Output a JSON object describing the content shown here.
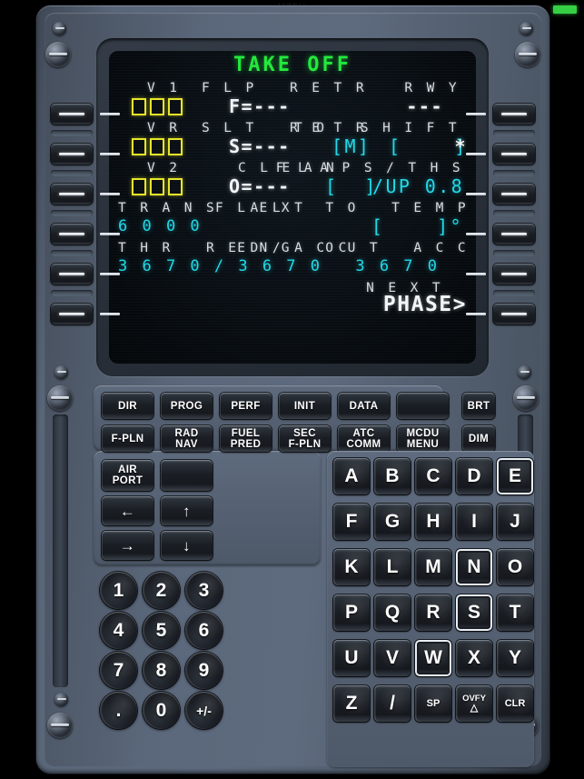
{
  "watermark": "MCDU",
  "status_led": {
    "name": "recording-indicator",
    "color": "#35cf45"
  },
  "display": {
    "title": "TAKE OFF",
    "rows": [
      {
        "label_left": "V1",
        "label_center": "FLP RETR",
        "label_right": "RWY"
      },
      {
        "value_left": "[][][]",
        "value_center": "F=---",
        "value_right": "---"
      },
      {
        "label_left": "VR",
        "label_center": "SLT RETR",
        "label_right": "TO SHIFT"
      },
      {
        "value_left": "[][][]",
        "value_center": "S=---",
        "value_right": "[M] [    ]*"
      },
      {
        "label_left": "V2",
        "label_center": "CLEAN",
        "label_right": "FLAPS/THS"
      },
      {
        "value_left": "[][][]",
        "value_center": "O=---",
        "value_right": "[  ]/UP 0.8"
      },
      {
        "label_left": "TRANS ALT",
        "label_right": "FLEX TO TEMP"
      },
      {
        "value_left": "6000",
        "value_right": "[    ]°"
      },
      {
        "label_left": "THR RED/ACC",
        "label_right": "ENG OUT ACC"
      },
      {
        "value_left": "3670/3670",
        "value_right": "3670"
      },
      {
        "label_right": "NEXT"
      },
      {
        "value_right": "PHASE>"
      }
    ],
    "fields": {
      "v1_label": "V 1",
      "vr_label": "V R",
      "v2_label": "V 2",
      "flp_retr_label": "F L P   R E T R",
      "slt_retr_label": "S L T   R E T R",
      "clean_label": "C L E A N",
      "rwy_label": "R W Y",
      "to_shift_label": "T O   S H I F T",
      "flaps_ths_label": "F L A P S / T H S",
      "trans_alt_label": "T R A N S   A L T",
      "flex_to_temp_label": "F L E X   T O   T E M P",
      "thr_red_acc_label": "T H R   R E D / A C C",
      "eng_out_acc_label": "E N G   O U T   A C C",
      "next_label": "N E X T",
      "flp_retr_value": "F=---",
      "slt_retr_value": "S=---",
      "clean_value": "O=---",
      "rwy_value": "---",
      "to_shift_m": "[M]",
      "to_shift_brackets": "[    ]",
      "to_shift_star": "*",
      "flaps_brackets": "[  ]",
      "flaps_ths_value": "/UP 0.8",
      "trans_alt_value": "6 0 0 0",
      "flex_temp_value": "[    ]°",
      "thr_red_acc_value": "3 6 7 0 / 3 6 7 0",
      "eng_out_acc_value": "3 6 7 0",
      "phase_value": "PHASE>"
    },
    "colors": {
      "title_green": "#22e83c",
      "label_white": "#d7dde3",
      "value_white": "#f2f5f8",
      "value_cyan": "#21d9e8",
      "entry_amber": "#e8e52a",
      "screen_bg": "#080d12"
    }
  },
  "lsk": {
    "left": [
      "lsk-l1",
      "lsk-l2",
      "lsk-l3",
      "lsk-l4",
      "lsk-l5",
      "lsk-l6"
    ],
    "right": [
      "lsk-r1",
      "lsk-r2",
      "lsk-r3",
      "lsk-r4",
      "lsk-r5",
      "lsk-r6"
    ]
  },
  "function_keys": {
    "row1": [
      {
        "name": "dir",
        "line1": "DIR",
        "line2": ""
      },
      {
        "name": "prog",
        "line1": "PROG",
        "line2": ""
      },
      {
        "name": "perf",
        "line1": "PERF",
        "line2": ""
      },
      {
        "name": "init",
        "line1": "INIT",
        "line2": ""
      },
      {
        "name": "data",
        "line1": "DATA",
        "line2": ""
      },
      {
        "name": "blank-1",
        "line1": "",
        "line2": ""
      }
    ],
    "row2": [
      {
        "name": "f-pln",
        "line1": "F-PLN",
        "line2": ""
      },
      {
        "name": "rad-nav",
        "line1": "RAD",
        "line2": "NAV"
      },
      {
        "name": "fuel-pred",
        "line1": "FUEL",
        "line2": "PRED"
      },
      {
        "name": "sec-f-pln",
        "line1": "SEC",
        "line2": "F-PLN"
      },
      {
        "name": "atc-comm",
        "line1": "ATC",
        "line2": "COMM"
      },
      {
        "name": "mcdu-menu",
        "line1": "MCDU",
        "line2": "MENU"
      }
    ],
    "row3": [
      {
        "name": "airport",
        "line1": "AIR",
        "line2": "PORT"
      },
      {
        "name": "blank-2",
        "line1": "",
        "line2": ""
      }
    ],
    "brightness": [
      {
        "name": "brt",
        "line1": "BRT",
        "line2": ""
      },
      {
        "name": "dim",
        "line1": "DIM",
        "line2": ""
      }
    ],
    "arrows": [
      {
        "name": "arrow-left",
        "glyph": "←"
      },
      {
        "name": "arrow-up",
        "glyph": "↑"
      },
      {
        "name": "arrow-right",
        "glyph": "→"
      },
      {
        "name": "arrow-down",
        "glyph": "↓"
      }
    ]
  },
  "alpha_keys": [
    {
      "k": "A",
      "hl": false
    },
    {
      "k": "B",
      "hl": false
    },
    {
      "k": "C",
      "hl": false
    },
    {
      "k": "D",
      "hl": false
    },
    {
      "k": "E",
      "hl": true
    },
    {
      "k": "F",
      "hl": false
    },
    {
      "k": "G",
      "hl": false
    },
    {
      "k": "H",
      "hl": false
    },
    {
      "k": "I",
      "hl": false
    },
    {
      "k": "J",
      "hl": false
    },
    {
      "k": "K",
      "hl": false
    },
    {
      "k": "L",
      "hl": false
    },
    {
      "k": "M",
      "hl": false
    },
    {
      "k": "N",
      "hl": true
    },
    {
      "k": "O",
      "hl": false
    },
    {
      "k": "P",
      "hl": false
    },
    {
      "k": "Q",
      "hl": false
    },
    {
      "k": "R",
      "hl": false
    },
    {
      "k": "S",
      "hl": true
    },
    {
      "k": "T",
      "hl": false
    },
    {
      "k": "U",
      "hl": false
    },
    {
      "k": "V",
      "hl": false
    },
    {
      "k": "W",
      "hl": true
    },
    {
      "k": "X",
      "hl": false
    },
    {
      "k": "Y",
      "hl": false
    },
    {
      "k": "Z",
      "hl": false
    },
    {
      "k": "/",
      "hl": false
    },
    {
      "k": "SP",
      "hl": false
    },
    {
      "k": "OVFY",
      "k2": "△",
      "hl": false
    },
    {
      "k": "CLR",
      "hl": false
    }
  ],
  "num_keys": [
    {
      "k": "1"
    },
    {
      "k": "2"
    },
    {
      "k": "3"
    },
    {
      "k": "4"
    },
    {
      "k": "5"
    },
    {
      "k": "6"
    },
    {
      "k": "7"
    },
    {
      "k": "8"
    },
    {
      "k": "9"
    },
    {
      "k": "."
    },
    {
      "k": "0"
    },
    {
      "k": "+/-"
    }
  ]
}
